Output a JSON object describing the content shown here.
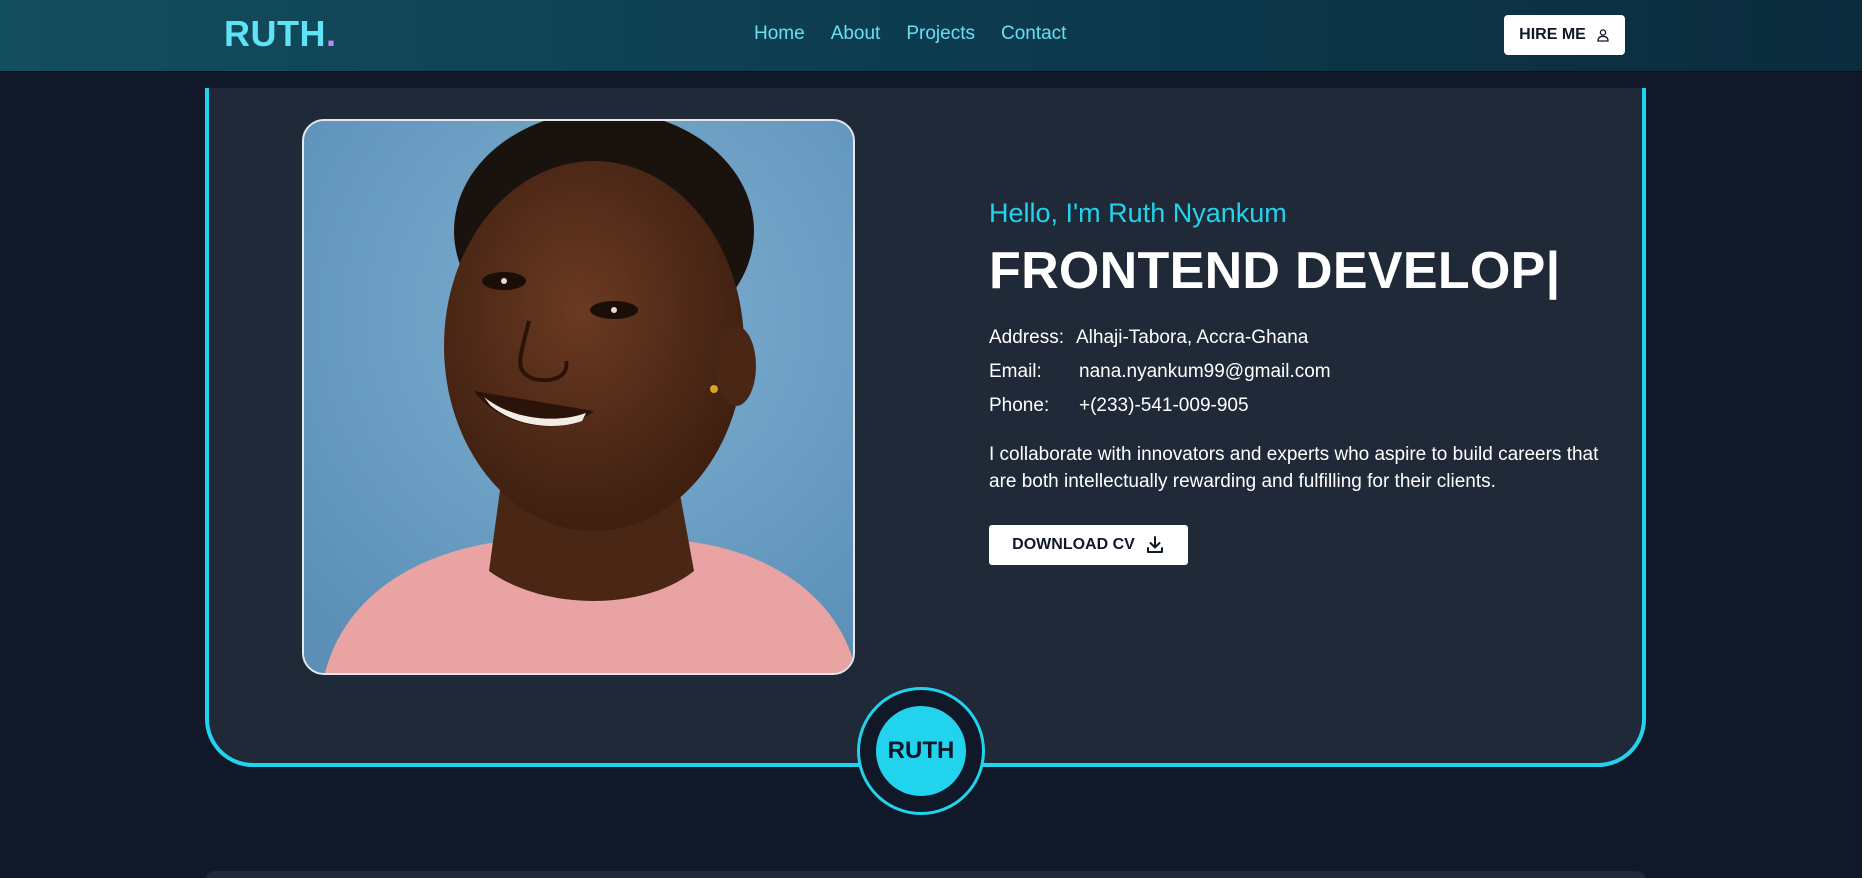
{
  "header": {
    "logo_text": "RUTH",
    "logo_dot": ".",
    "nav": [
      "Home",
      "About",
      "Projects",
      "Contact"
    ],
    "hire_label": "HIRE ME",
    "hire_icon": "user-icon"
  },
  "hero": {
    "greeting": "Hello, I'm Ruth Nyankum",
    "role": "FRONTEND DEVELOP|",
    "address_label": "Address:",
    "address_value": "Alhaji-Tabora, Accra-Ghana",
    "email_label": "Email:",
    "email_value": "nana.nyankum99@gmail.com",
    "phone_label": "Phone:",
    "phone_value": "+(233)-541-009-905",
    "bio": "I collaborate with innovators and experts who aspire to build careers that are both intellectually rewarding and fulfilling for their clients.",
    "cv_label": "DOWNLOAD CV",
    "cv_icon": "download-icon",
    "badge_text": "RUTH"
  },
  "colors": {
    "accent": "#22d3ee",
    "logo": "#5fe3f5",
    "logo_dot": "#c084fc",
    "background": "#111827",
    "card": "#1f2937"
  }
}
